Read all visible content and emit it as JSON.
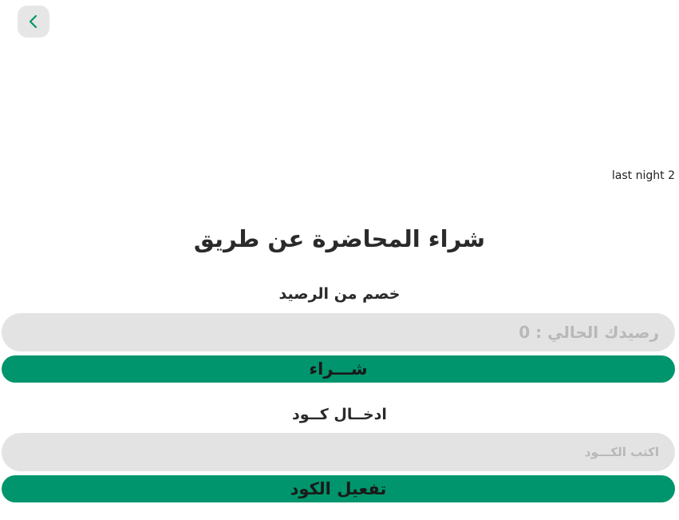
{
  "header": {
    "back_icon": "chevron-left-icon"
  },
  "lecture": {
    "name": "last night 2"
  },
  "purchase": {
    "title": "شراء المحاضرة عن طريق"
  },
  "balance_section": {
    "label": "خصم من الرصيد",
    "balance_text": "رصيدك الحالي : 0",
    "buy_button": "شـــراء"
  },
  "code_section": {
    "label": "ادخــال كــود",
    "placeholder": "اكتب الكـــود",
    "activate_button": "تفعيل الكود"
  },
  "colors": {
    "accent": "#00956c",
    "field_bg": "#e3e3e3",
    "back_bg": "#e6e6e6",
    "icon": "#00956c"
  }
}
